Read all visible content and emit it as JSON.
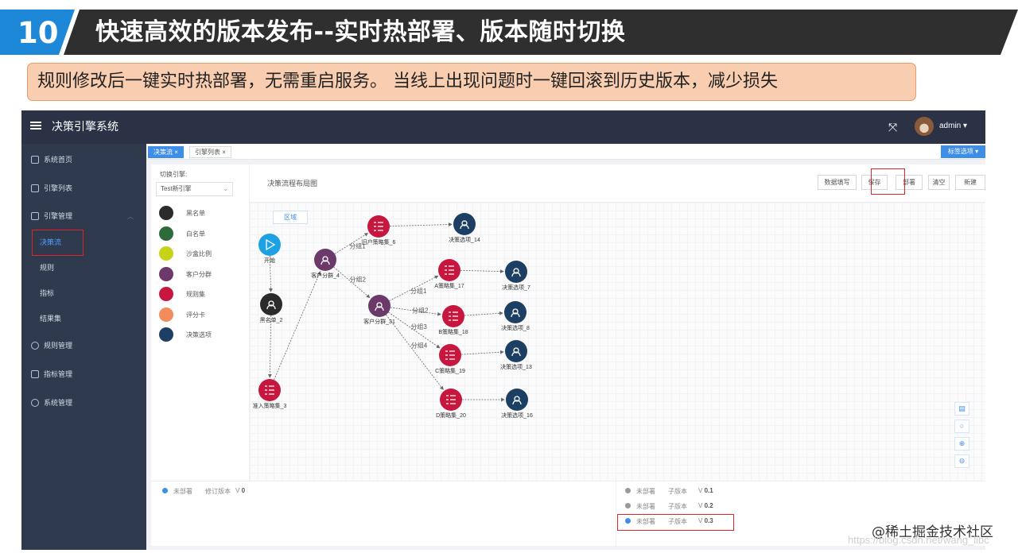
{
  "slide": {
    "number": "10",
    "title": "快速高效的版本发布--实时热部署、版本随时切换",
    "subtitle": "规则修改后一键实时热部署，无需重启服务。 当线上出现问题时一键回滚到历史版本，减少损失",
    "watermark": "@稀土掘金技术社区",
    "watermark_url": "https://blog.csdn.net/wang_libc"
  },
  "app": {
    "title": "决策引擎系统",
    "user": "admin",
    "user_caret": "▾",
    "fullscreen_glyph": "⤧",
    "menu_icon": "hamburger-icon"
  },
  "sidebar": {
    "items": [
      {
        "label": "系统首页",
        "icon": "home-icon"
      },
      {
        "label": "引擎列表",
        "icon": "list-icon"
      },
      {
        "label": "引擎管理",
        "icon": "grid-icon",
        "caret": "︿"
      },
      {
        "label": "规则管理",
        "icon": "globe-icon"
      },
      {
        "label": "指标管理",
        "icon": "book-icon"
      },
      {
        "label": "系统管理",
        "icon": "gear-icon"
      }
    ],
    "subitems": [
      "决策流",
      "规则",
      "指标",
      "结果集"
    ],
    "active_subitem": "决策流"
  },
  "tabs": {
    "items": [
      {
        "label": "决策流",
        "close": "×",
        "active": true
      },
      {
        "label": "引擎列表",
        "close": "×",
        "active": false
      }
    ],
    "options_label": "标签选项 ▾"
  },
  "palette": {
    "engine_label": "切换引擎:",
    "engine_value": "Test新引擎",
    "engine_chevron": "⌄",
    "items": [
      {
        "label": "黑名单",
        "color": "#2b2b2b"
      },
      {
        "label": "白名单",
        "color": "#2e6b3a"
      },
      {
        "label": "沙盒比例",
        "color": "#c9d21a"
      },
      {
        "label": "客户分群",
        "color": "#6b3a6b"
      },
      {
        "label": "规则集",
        "color": "#c8173f"
      },
      {
        "label": "评分卡",
        "color": "#f28c5c"
      },
      {
        "label": "决策选项",
        "color": "#1c3f63"
      }
    ]
  },
  "canvas": {
    "title": "决策流程布局图",
    "region_label": "区域",
    "buttons": [
      "数据填写",
      "保存",
      "部署",
      "清空",
      "新建"
    ],
    "tools": [
      "page-icon",
      "search-icon",
      "zoom-in-icon",
      "zoom-out-icon"
    ],
    "tool_glyphs": [
      "▤",
      "○",
      "⊕",
      "⊖"
    ],
    "nodes": [
      {
        "id": "start",
        "label": "开始",
        "type": "start"
      },
      {
        "id": "black2",
        "label": "黑名单_2",
        "type": "blacklist"
      },
      {
        "id": "rule3",
        "label": "准入策略集_3",
        "type": "ruleset"
      },
      {
        "id": "seg4",
        "label": "客户分群_4",
        "type": "segment"
      },
      {
        "id": "rule6",
        "label": "旧户策略集_6",
        "type": "ruleset"
      },
      {
        "id": "dec14",
        "label": "决策选项_14",
        "type": "decision"
      },
      {
        "id": "seg31",
        "label": "客户分群_31",
        "type": "segment"
      },
      {
        "id": "rule17",
        "label": "A策略集_17",
        "type": "ruleset"
      },
      {
        "id": "dec7",
        "label": "决策选项_7",
        "type": "decision"
      },
      {
        "id": "rule18",
        "label": "B策略集_18",
        "type": "ruleset"
      },
      {
        "id": "dec8",
        "label": "决策选项_8",
        "type": "decision"
      },
      {
        "id": "rule19",
        "label": "C策略集_19",
        "type": "ruleset"
      },
      {
        "id": "dec13",
        "label": "决策选项_13",
        "type": "decision"
      },
      {
        "id": "rule20",
        "label": "D策略集_20",
        "type": "ruleset"
      },
      {
        "id": "dec16",
        "label": "决策选项_16",
        "type": "decision"
      }
    ],
    "edges": [
      {
        "from": "start",
        "to": "black2",
        "label": ""
      },
      {
        "from": "black2",
        "to": "rule3",
        "label": ""
      },
      {
        "from": "rule3",
        "to": "seg4",
        "label": ""
      },
      {
        "from": "seg4",
        "to": "rule6",
        "label": "分组1"
      },
      {
        "from": "seg4",
        "to": "seg31",
        "label": "分组2"
      },
      {
        "from": "rule6",
        "to": "dec14",
        "label": ""
      },
      {
        "from": "seg31",
        "to": "rule17",
        "label": "分组1"
      },
      {
        "from": "seg31",
        "to": "rule18",
        "label": "分组2"
      },
      {
        "from": "seg31",
        "to": "rule19",
        "label": "分组3"
      },
      {
        "from": "seg31",
        "to": "rule20",
        "label": "分组4"
      },
      {
        "from": "rule17",
        "to": "dec7",
        "label": ""
      },
      {
        "from": "rule18",
        "to": "dec8",
        "label": ""
      },
      {
        "from": "rule19",
        "to": "dec13",
        "label": ""
      },
      {
        "from": "rule20",
        "to": "dec16",
        "label": ""
      }
    ]
  },
  "versions": {
    "main": {
      "status": "未部署",
      "kind": "修订版本",
      "prefix": "V",
      "version": "0",
      "dot": "#3c8ee8"
    },
    "subs": [
      {
        "status": "未部署",
        "kind": "子版本",
        "prefix": "V",
        "version": "0.1",
        "dot": "#9a9a9a"
      },
      {
        "status": "未部署",
        "kind": "子版本",
        "prefix": "V",
        "version": "0.2",
        "dot": "#9a9a9a"
      },
      {
        "status": "未部署",
        "kind": "子版本",
        "prefix": "V",
        "version": "0.3",
        "dot": "#3c8ee8"
      }
    ]
  },
  "colors": {
    "header_dark": "#2f2f2f",
    "header_blue": "#1e88d8",
    "accent": "#3c8ee8",
    "highlight": "#e0242a",
    "subtitle_bg": "#f9cdb0"
  }
}
